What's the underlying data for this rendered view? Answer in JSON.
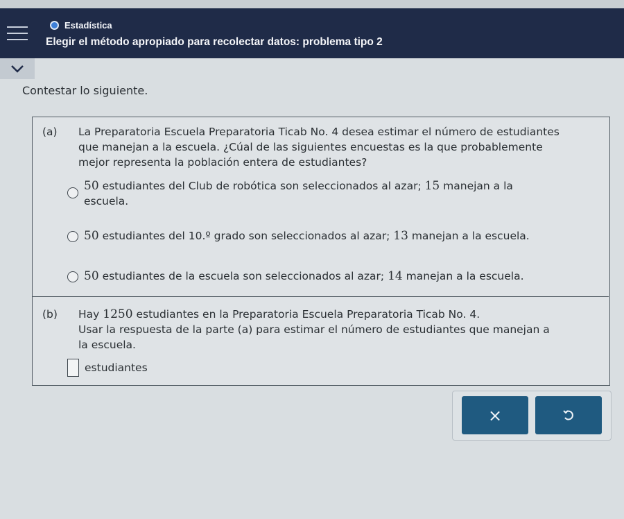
{
  "header": {
    "topic": "Estadística",
    "title": "Elegir el método apropiado para recolectar datos: problema tipo 2"
  },
  "instruction": "Contestar lo siguiente.",
  "part_a": {
    "label": "(a)",
    "question_line1": "La Preparatoria Escuela Preparatoria Ticab No. 4 desea estimar el número de estudiantes",
    "question_line2": "que manejan a la escuela. ¿Cúal de las siguientes encuestas es la que probablemente",
    "question_line3": "mejor representa la población entera de estudiantes?",
    "options": [
      {
        "n1": "50",
        "t1": " estudiantes del Club de robótica son seleccionados al azar; ",
        "n2": "15",
        "t2": " manejan a la",
        "t3": "escuela."
      },
      {
        "n1": "50",
        "t1": " estudiantes del ",
        "grade": "10.º",
        "t1b": " grado son seleccionados al azar; ",
        "n2": "13",
        "t2": " manejan a la escuela."
      },
      {
        "n1": "50",
        "t1": " estudiantes de la escuela son seleccionados al azar; ",
        "n2": "14",
        "t2": " manejan a la escuela."
      }
    ]
  },
  "part_b": {
    "label": "(b)",
    "line1_pre": "Hay ",
    "line1_num": "1250",
    "line1_post": " estudiantes en la Preparatoria Escuela Preparatoria Ticab No. 4.",
    "line2": "Usar la respuesta de la parte (a) para estimar el número de estudiantes que manejan a",
    "line3": "la escuela.",
    "answer_value": "",
    "answer_unit": "estudiantes"
  },
  "buttons": {
    "clear_label": "×",
    "undo_label": "↺"
  }
}
